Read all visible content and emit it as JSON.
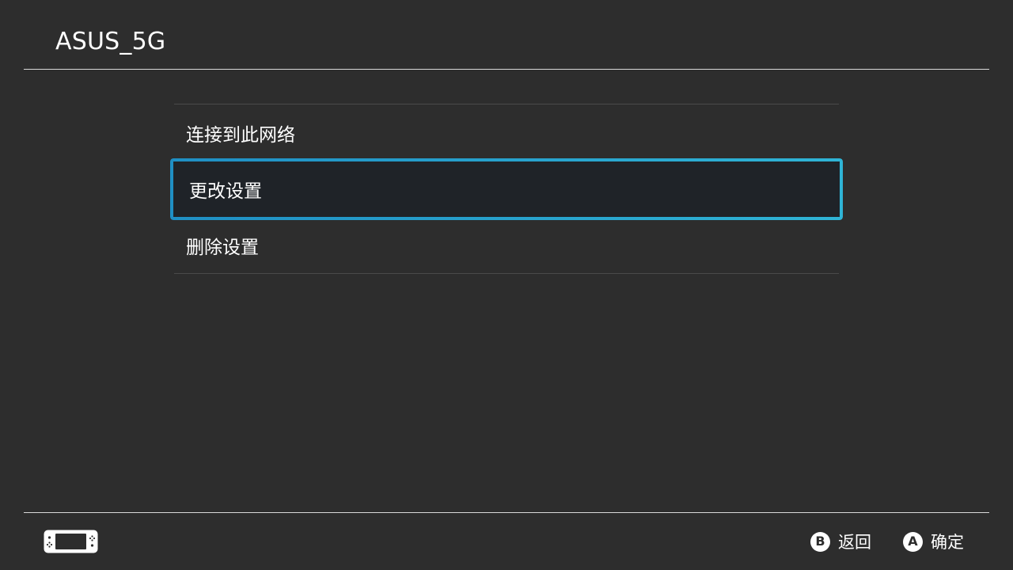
{
  "header": {
    "title": "ASUS_5G"
  },
  "menu": {
    "items": [
      {
        "label": "连接到此网络",
        "selected": false
      },
      {
        "label": "更改设置",
        "selected": true
      },
      {
        "label": "删除设置",
        "selected": false
      }
    ]
  },
  "footer": {
    "console_icon": "handheld-console-icon",
    "actions": [
      {
        "button": "B",
        "label": "返回"
      },
      {
        "button": "A",
        "label": "确定"
      }
    ]
  },
  "colors": {
    "background": "#2d2d2d",
    "selection_border": "#2fb4d6",
    "selection_fill": "#1f2328",
    "text": "#ffffff"
  }
}
